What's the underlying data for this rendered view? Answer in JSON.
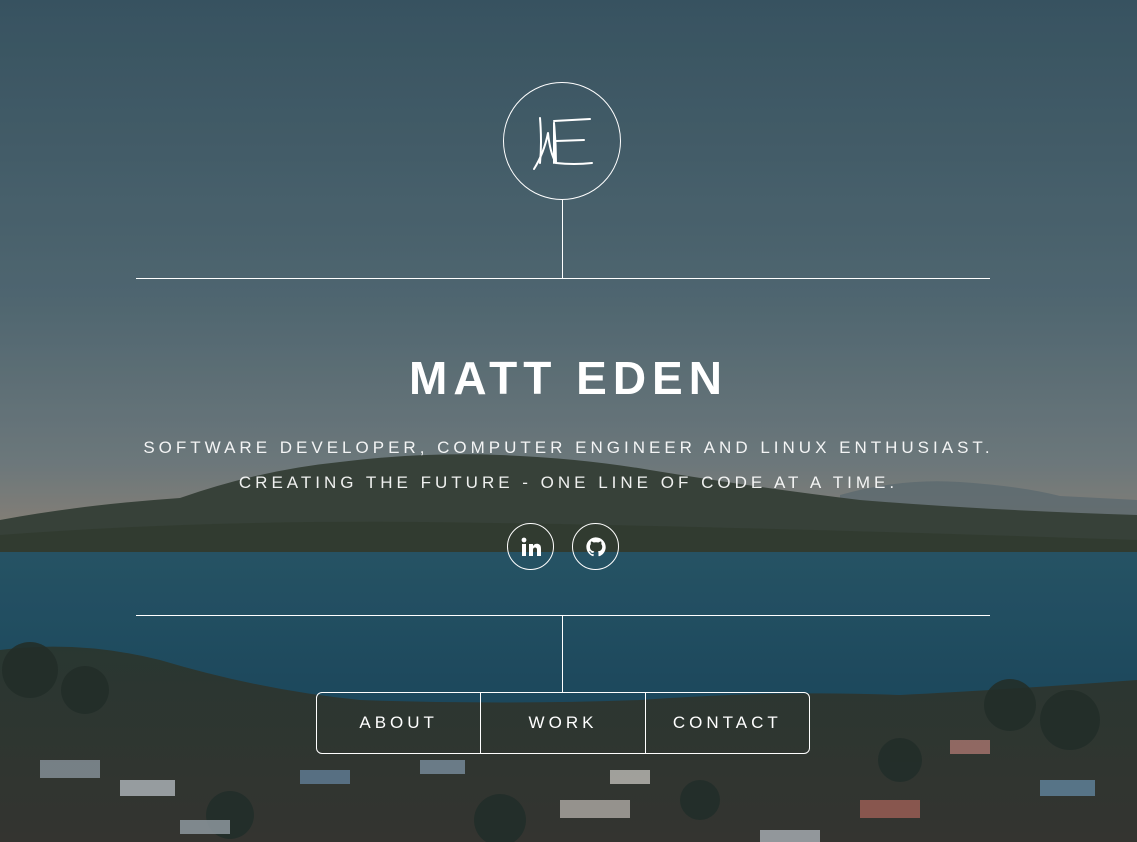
{
  "header": {
    "logo_icon": "signature-monogram-icon"
  },
  "hero": {
    "name": "MATT EDEN",
    "tagline_line1": "SOFTWARE DEVELOPER, COMPUTER ENGINEER AND LINUX ENTHUSIAST.",
    "tagline_line2": "CREATING THE FUTURE - ONE LINE OF CODE AT A TIME."
  },
  "social": [
    {
      "icon": "linkedin-icon"
    },
    {
      "icon": "github-icon"
    }
  ],
  "nav": {
    "items": [
      {
        "label": "ABOUT"
      },
      {
        "label": "WORK"
      },
      {
        "label": "CONTACT"
      }
    ]
  },
  "colors": {
    "text": "#ffffff",
    "sky": "#4a6a78",
    "sea": "#1f5a6e",
    "island": "#3c4a3c"
  }
}
